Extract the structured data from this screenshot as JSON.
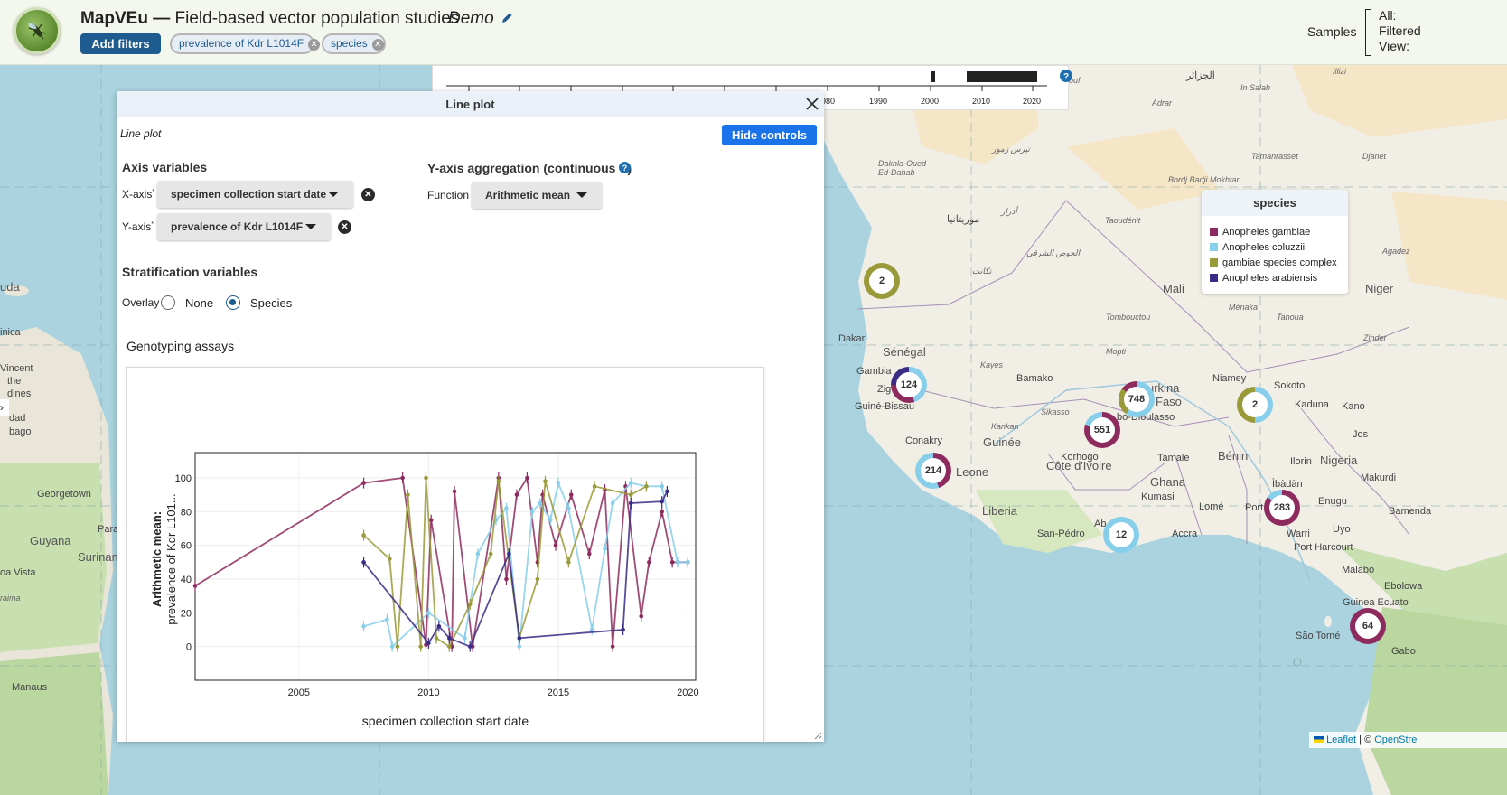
{
  "header": {
    "app_name": "MapVEu",
    "app_subtitle": "Field-based vector population studies",
    "study_name": "Demo",
    "add_filters_label": "Add filters",
    "filter_chips": [
      {
        "label": "prevalence of Kdr L1014F"
      },
      {
        "label": "species"
      }
    ],
    "samples_label": "Samples",
    "sample_counts": [
      {
        "label": "All:"
      },
      {
        "label": "Filtered"
      },
      {
        "label": "View:"
      }
    ]
  },
  "timeline": {
    "ticks": [
      "980",
      "1990",
      "2000",
      "2010",
      "2020"
    ]
  },
  "legend": {
    "title": "species",
    "items": [
      {
        "label": "Anopheles gambiae",
        "color": "#8e2b5e"
      },
      {
        "label": "Anopheles coluzzii",
        "color": "#87ceeb"
      },
      {
        "label": "gambiae species complex",
        "color": "#9a9a3a"
      },
      {
        "label": "Anopheles arabiensis",
        "color": "#3b2c86"
      }
    ]
  },
  "map": {
    "clusters": [
      {
        "count": "2"
      },
      {
        "count": "124"
      },
      {
        "count": "748"
      },
      {
        "count": "2"
      },
      {
        "count": "551"
      },
      {
        "count": "214"
      },
      {
        "count": "12"
      },
      {
        "count": "283"
      },
      {
        "count": "64"
      }
    ],
    "labels": {
      "senegal": "Sénégal",
      "dakar": "Dakar",
      "gambia": "Gambia",
      "zig": "Zig",
      "guine_bissau": "Guiné-Bissau",
      "conakry": "Conakry",
      "guinee": "Guinée",
      "leone": "Leone",
      "liberia": "Liberia",
      "cote": "Côte d'Ivoire",
      "ghana": "Ghana",
      "mali": "Mali",
      "niger": "Niger",
      "nigeria": "Nigeria",
      "benin": "Bénin",
      "bamako": "Bamako",
      "niamey": "Niamey",
      "kano": "Kano",
      "kaduna": "Kaduna",
      "sokoto": "Sokoto",
      "burkina": "urkina",
      "faso": "Faso",
      "dioulasso": "bo-Dioulasso",
      "korhogo": "Korhogo",
      "tamale": "Tamale",
      "kumasi": "Kumasi",
      "accra": "Accra",
      "lome": "Lomé",
      "port": "Port",
      "san_pedro": "San-Pédro",
      "abidjan": "Ab",
      "ibadan": "Ìbàdàn",
      "ilorin": "Ilorin",
      "makurdi": "Makurdi",
      "enugu": "Enugu",
      "uyo": "Uyo",
      "port_harcourt": "Port Harcourt",
      "warri": "Warri",
      "bamenda": "Bamenda",
      "malabo": "Malabo",
      "guinea_ecuato": "Guinea Ecuato",
      "sao_tome": "São Tomé",
      "jos": "Jos",
      "tamanrasset": "Tamanrasset",
      "djanet": "Djanet",
      "in_salah": "In Salah",
      "adrar": "Adrar",
      "taoudenit": "Taoudénit",
      "tombouctou": "Tombouctou",
      "menaka": "Ménaka",
      "tahoua": "Tahoua",
      "zinder": "Zinder",
      "agadez": "Agadez",
      "mopti": "Mopti",
      "kayes": "Kayes",
      "kankan": "Kankan",
      "sikasso": "Sikasso",
      "georgetown": "Georgetown",
      "guyana": "Guyana",
      "surinam": "Surinam",
      "manaus": "Manaus",
      "boa_vista": "oa Vista",
      "para": "Para",
      "dakhla": "Dakhla-Oued Ed-Dahab",
      "mauritanie": "موريتانيا",
      "jazair": "الجزائر",
      "ebolowa": "Ebolowa",
      "gabo": "Gabo",
      "bordj": "Bordj Badji Mokhtar",
      "tiris": "تيرس زمور",
      "hodh": "الحوض الشرقي",
      "adrar_ar": "أدرار",
      "tagant": "تكانت",
      "uda": "uda",
      "inica": "inica",
      "vincent": "Vincent",
      "the": "the",
      "dines": "dines",
      "dad": "dad",
      "bago": "bago",
      "raima": "raima",
      "ouf": "ouf",
      "illizi": "Illizi"
    }
  },
  "panel": {
    "title": "Line plot",
    "subtitle": "Line plot",
    "hide_controls_label": "Hide controls",
    "axis_variables_title": "Axis variables",
    "x_axis_label": "X-axis",
    "x_axis_value": "specimen collection start date",
    "y_axis_label": "Y-axis",
    "y_axis_value": "prevalence of Kdr L1014F",
    "required_mark": "*",
    "aggregation_title": "Y-axis aggregation (continuous Y)",
    "function_label": "Function",
    "function_value": "Arithmetic mean",
    "stratification_title": "Stratification variables",
    "overlay_label": "Overlay",
    "overlay_options": [
      {
        "label": "None",
        "selected": false
      },
      {
        "label": "Species",
        "selected": true
      }
    ],
    "plot_section_title": "Genotyping assays"
  },
  "attribution": {
    "leaflet": "Leaflet",
    "sep": " | © ",
    "osm": "OpenStre"
  },
  "chart_data": {
    "type": "line",
    "title": "",
    "xlabel": "specimen collection start date",
    "ylabel_line1": "Arithmetic mean:",
    "ylabel_line2": "prevalence of Kdr L101...",
    "xlim": [
      2001,
      2020.3
    ],
    "ylim": [
      -20,
      115
    ],
    "x_ticks": [
      2005,
      2010,
      2015,
      2020
    ],
    "y_ticks": [
      0,
      20,
      40,
      60,
      80,
      100
    ],
    "grid": true,
    "legend": "none",
    "series": [
      {
        "color": "#8e2b5e",
        "x": [
          2001.0,
          2007.5,
          2009.0,
          2009.9,
          2010.1,
          2010.9,
          2011.0,
          2011.7,
          2012.7,
          2013.0,
          2013.4,
          2013.8,
          2014.2,
          2014.4,
          2014.9,
          2015.5,
          2016.2,
          2016.8,
          2017.1,
          2017.6,
          2018.2,
          2018.5,
          2019.0,
          2019.4,
          2020.0
        ],
        "y": [
          36,
          97,
          100,
          1,
          75,
          0,
          92,
          0,
          100,
          40,
          90,
          100,
          50,
          90,
          60,
          90,
          55,
          93,
          0,
          95,
          18,
          50,
          80,
          50,
          50
        ]
      },
      {
        "color": "#87ceeb",
        "x": [
          2007.5,
          2008.4,
          2008.6,
          2010.0,
          2011.4,
          2011.9,
          2012.6,
          2013.0,
          2013.5,
          2014.0,
          2014.3,
          2014.7,
          2015.0,
          2015.4,
          2016.3,
          2016.8,
          2017.1,
          2017.8,
          2018.4,
          2019.0,
          2019.6,
          2020.0
        ],
        "y": [
          12,
          16,
          0,
          20,
          5,
          55,
          75,
          82,
          0,
          80,
          85,
          75,
          97,
          82,
          10,
          58,
          85,
          97,
          95,
          95,
          50,
          50
        ]
      },
      {
        "color": "#9a9a3a",
        "x": [
          2007.5,
          2008.5,
          2008.8,
          2009.2,
          2009.7,
          2009.9,
          2010.3,
          2010.8,
          2011.6,
          2012.4,
          2012.7,
          2013.5,
          2014.2,
          2014.5,
          2015.4,
          2016.4,
          2017.8,
          2018.4
        ],
        "y": [
          66,
          52,
          0,
          90,
          0,
          100,
          5,
          0,
          25,
          55,
          98,
          5,
          40,
          98,
          50,
          95,
          90,
          95
        ]
      },
      {
        "color": "#3b2c86",
        "x": [
          2007.5,
          2010.0,
          2010.4,
          2010.8,
          2011.6,
          2013.1,
          2013.5,
          2017.5,
          2017.8,
          2019.0,
          2019.2
        ],
        "y": [
          50,
          2,
          12,
          5,
          0,
          55,
          5,
          10,
          85,
          86,
          92
        ]
      }
    ]
  }
}
